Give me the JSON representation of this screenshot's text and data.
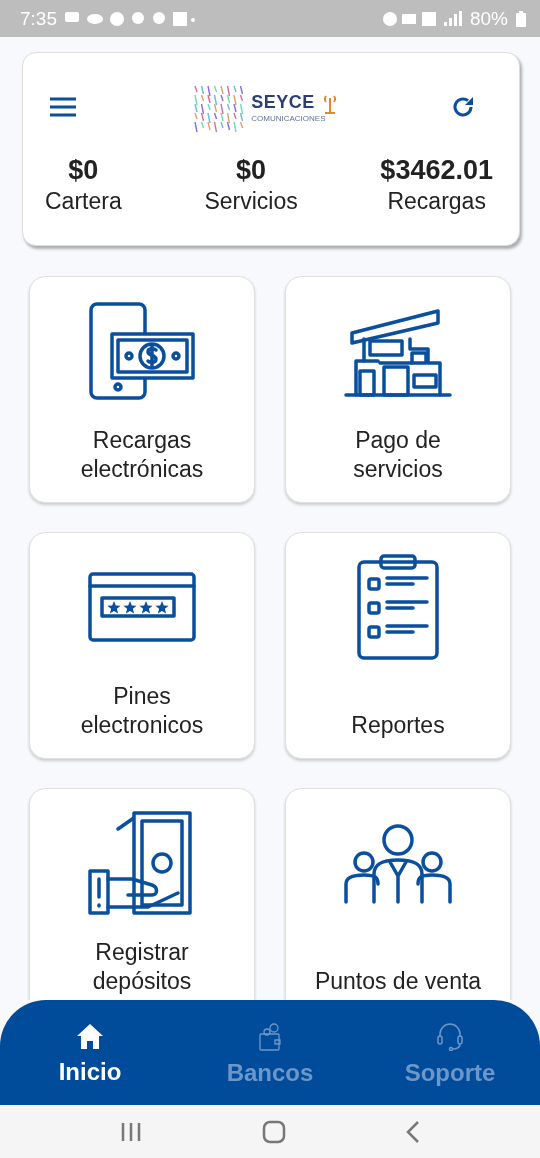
{
  "status_bar": {
    "time": "7:35",
    "battery": "80%"
  },
  "header": {
    "logo": {
      "name": "SEYCE",
      "tagline": "COMUNICACIONES"
    },
    "balances": [
      {
        "amount": "$0",
        "label": "Cartera"
      },
      {
        "amount": "$0",
        "label": "Servicios"
      },
      {
        "amount": "$3462.01",
        "label": "Recargas"
      }
    ]
  },
  "tiles": [
    {
      "kind": "phone",
      "label": "Recargas electrónicas"
    },
    {
      "kind": "building",
      "label": "Pago de servicios"
    },
    {
      "kind": "card",
      "label": "Pines electronicos"
    },
    {
      "kind": "clipboard",
      "label": "Reportes"
    },
    {
      "kind": "cash",
      "label": "Registrar depósitos"
    },
    {
      "kind": "people",
      "label": "Puntos de venta"
    }
  ],
  "bottom_nav": [
    {
      "kind": "home",
      "label": "Inicio",
      "selected": true
    },
    {
      "kind": "wallet",
      "label": "Bancos",
      "selected": false
    },
    {
      "kind": "headset",
      "label": "Soporte",
      "selected": false
    }
  ]
}
